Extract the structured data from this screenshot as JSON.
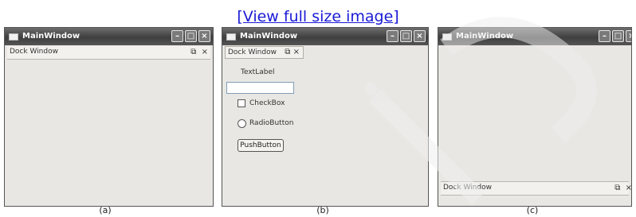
{
  "link_text": "[View full size image]",
  "window_title": "MainWindow",
  "controls": {
    "minimize": "–",
    "maximize": "□",
    "close": "×"
  },
  "dock": {
    "title": "Dock Window",
    "float_icon": "float-icon",
    "float_glyph": "⧉",
    "close_glyph": "×"
  },
  "widgets": {
    "label": "TextLabel",
    "checkbox": "CheckBox",
    "radio": "RadioButton",
    "button": "PushButton"
  },
  "captions": [
    "(a)",
    "(b)",
    "(c)"
  ],
  "colors": {
    "link": "#1a1ad6",
    "titlebar": "#4a4a4a",
    "window_bg": "#e8e7e3"
  }
}
